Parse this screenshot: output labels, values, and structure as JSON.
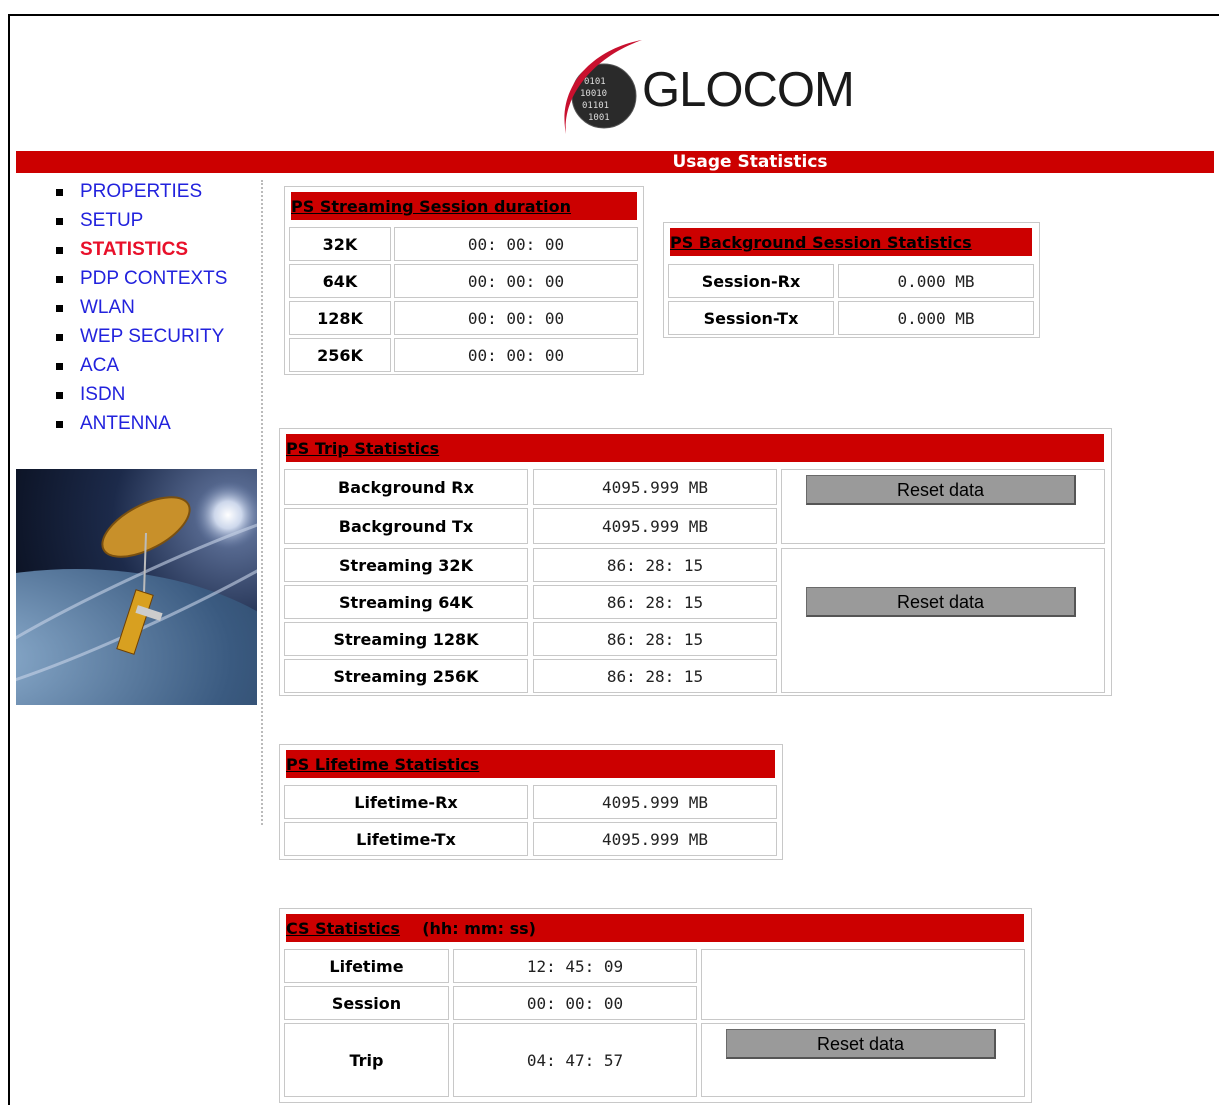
{
  "brand": {
    "name": "GLOCOM",
    "logo_icon": "globe-swoosh-icon"
  },
  "banner": {
    "title": "Usage Statistics",
    "color": "#cc0000"
  },
  "nav": {
    "items": [
      {
        "label": "PROPERTIES"
      },
      {
        "label": "SETUP"
      },
      {
        "label": "STATISTICS"
      },
      {
        "label": "PDP CONTEXTS"
      },
      {
        "label": "WLAN"
      },
      {
        "label": "WEP SECURITY"
      },
      {
        "label": "ACA"
      },
      {
        "label": "ISDN"
      },
      {
        "label": "ANTENNA"
      }
    ],
    "active": "STATISTICS"
  },
  "streaming": {
    "title": "PS Streaming Session duration",
    "rows": [
      {
        "label": "32K",
        "value": "00: 00: 00"
      },
      {
        "label": "64K",
        "value": "00: 00: 00"
      },
      {
        "label": "128K",
        "value": "00: 00: 00"
      },
      {
        "label": "256K",
        "value": "00: 00: 00"
      }
    ]
  },
  "background": {
    "title": "PS Background Session Statistics",
    "rows": [
      {
        "label": "Session-Rx",
        "value": "0.000 MB"
      },
      {
        "label": "Session-Tx",
        "value": "0.000 MB"
      }
    ]
  },
  "trip": {
    "title": "PS Trip Statistics",
    "rows": [
      {
        "label": "Background Rx",
        "value": "4095.999 MB"
      },
      {
        "label": "Background Tx",
        "value": "4095.999 MB"
      },
      {
        "label": "Streaming 32K",
        "value": "86: 28: 15"
      },
      {
        "label": "Streaming 64K",
        "value": "86: 28: 15"
      },
      {
        "label": "Streaming 128K",
        "value": "86: 28: 15"
      },
      {
        "label": "Streaming 256K",
        "value": "86: 28: 15"
      }
    ],
    "reset_label_1": "Reset data",
    "reset_label_2": "Reset data"
  },
  "lifetime": {
    "title": "PS Lifetime Statistics",
    "rows": [
      {
        "label": "Lifetime-Rx",
        "value": "4095.999 MB"
      },
      {
        "label": "Lifetime-Tx",
        "value": "4095.999 MB"
      }
    ]
  },
  "cs": {
    "title": "CS Statistics",
    "unit": "(hh: mm: ss)",
    "rows": [
      {
        "label": "Lifetime",
        "value": "12: 45: 09"
      },
      {
        "label": "Session",
        "value": "00: 00: 00"
      },
      {
        "label": "Trip",
        "value": "04: 47: 57"
      }
    ],
    "reset_label": "Reset data"
  }
}
